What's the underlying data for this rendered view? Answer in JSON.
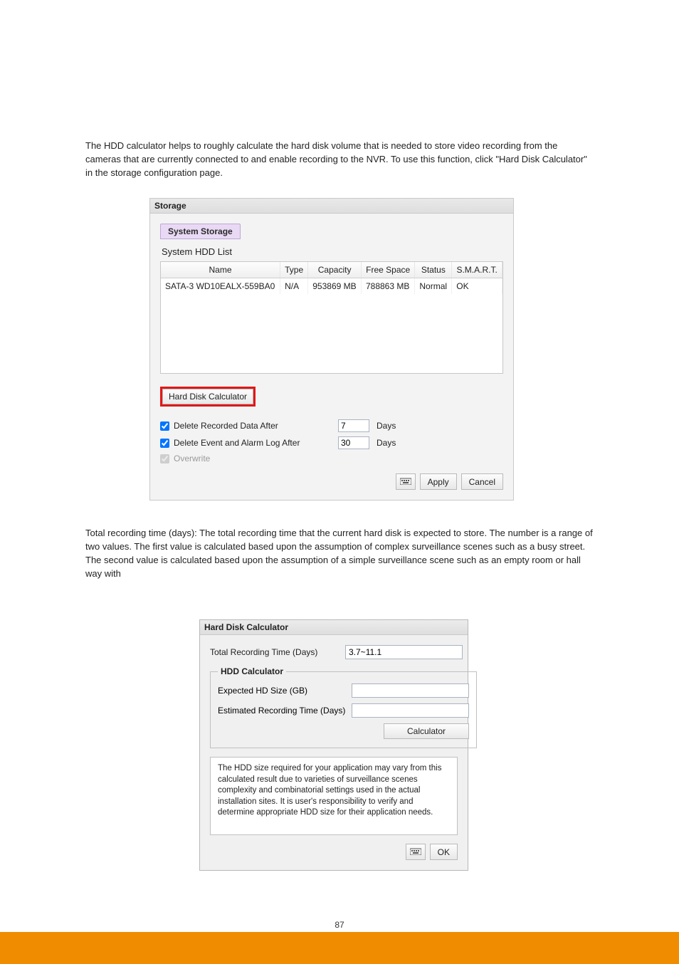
{
  "paragraphs": {
    "p1": "The HDD calculator helps to roughly calculate the hard disk volume that is needed to store video recording from the cameras that are currently connected to and enable recording to the NVR. To use this function, click \"Hard Disk Calculator\" in the storage configuration page.",
    "p2": "Total recording time (days): The total recording time that the current hard disk is expected to store. The number is a range of two values. The first value is calculated based upon the assumption of complex surveillance scenes such as a busy street. The second value is calculated based upon the assumption of a simple surveillance scene such as an empty room or hall way with"
  },
  "storage": {
    "title": "Storage",
    "tab": "System Storage",
    "hdd_list_label": "System HDD List",
    "columns": [
      "Name",
      "Type",
      "Capacity",
      "Free Space",
      "Status",
      "S.M.A.R.T."
    ],
    "rows": [
      {
        "name": "SATA-3 WD10EALX-559BA0",
        "type": "N/A",
        "capacity": "953869 MB",
        "free": "788863 MB",
        "status": "Normal",
        "smart": "OK"
      }
    ],
    "calc_button": "Hard Disk Calculator",
    "delete_recorded_label": "Delete Recorded Data After",
    "delete_recorded_value": "7",
    "delete_log_label": "Delete Event and Alarm Log After",
    "delete_log_value": "30",
    "days": "Days",
    "overwrite_label": "Overwrite",
    "apply": "Apply",
    "cancel": "Cancel"
  },
  "calc_dialog": {
    "title": "Hard Disk Calculator",
    "total_time_label": "Total Recording Time (Days)",
    "total_time_value": "3.7~11.1",
    "fieldset": "HDD Calculator",
    "expected_label": "Expected HD Size (GB)",
    "estimated_label": "Estimated Recording Time (Days)",
    "calc_button": "Calculator",
    "disclaimer": "The HDD size required for your application may vary from this calculated result due to varieties of surveillance scenes complexity and combinatorial settings used in the actual installation sites. It is user's responsibility to verify and determine appropriate HDD size for their application needs.",
    "ok": "OK"
  },
  "page_number": "87"
}
